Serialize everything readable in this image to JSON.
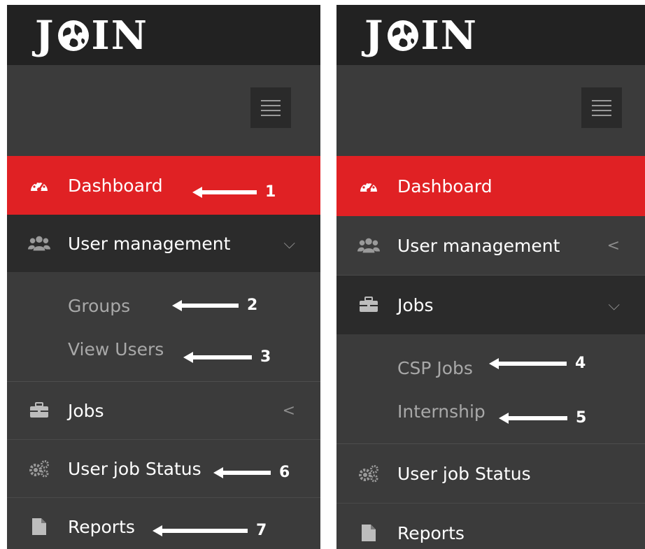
{
  "logo": {
    "text_left": "J",
    "text_right": "IN"
  },
  "left_panel": {
    "menu": {
      "dashboard": "Dashboard",
      "user_management": "User management",
      "user_management_chevron": "⌵",
      "groups": "Groups",
      "view_users": "View Users",
      "jobs": "Jobs",
      "jobs_chevron": "<",
      "user_job_status": "User job Status",
      "reports": "Reports"
    },
    "annotations": {
      "a1": "1",
      "a2": "2",
      "a3": "3",
      "a6": "6",
      "a7": "7"
    }
  },
  "right_panel": {
    "menu": {
      "dashboard": "Dashboard",
      "user_management": "User management",
      "user_management_chevron": "<",
      "jobs": "Jobs",
      "jobs_chevron": "⌵",
      "csp_jobs": "CSP Jobs",
      "internship": "Internship",
      "user_job_status": "User job Status",
      "reports": "Reports"
    },
    "annotations": {
      "a4": "4",
      "a5": "5"
    }
  },
  "colors": {
    "active": "#e02124",
    "sidebar": "#3b3b3b",
    "header": "#222222",
    "expanded": "#2b2b2b"
  },
  "icons": [
    "globe-icon",
    "dashboard-icon",
    "users-icon",
    "briefcase-icon",
    "gears-icon",
    "file-icon",
    "hamburger-icon"
  ]
}
